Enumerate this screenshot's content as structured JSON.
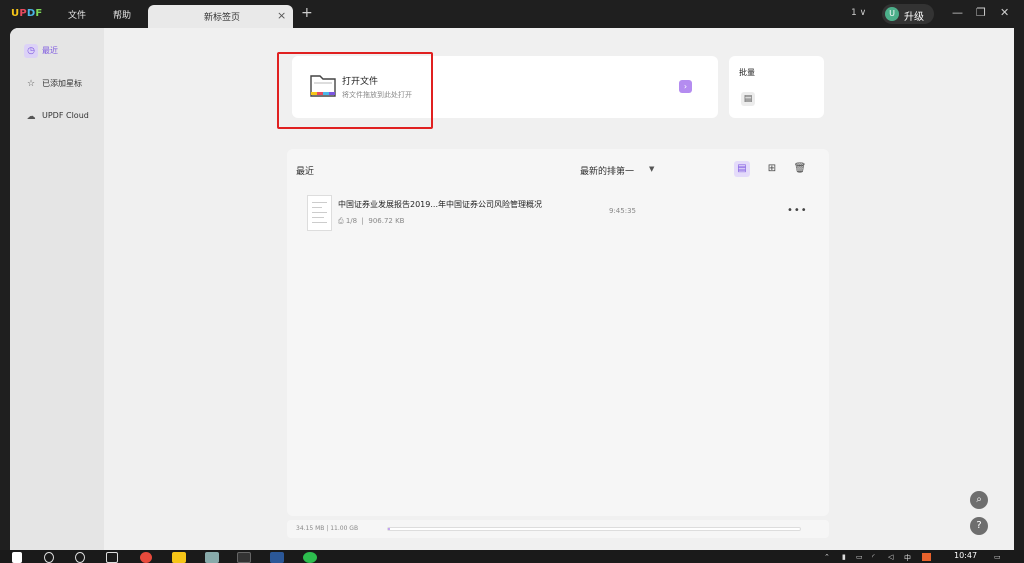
{
  "app": {
    "logo": [
      "U",
      "P",
      "D",
      "F"
    ],
    "menu": [
      "文件",
      "帮助"
    ],
    "tab_title": "新标签页",
    "tab_close": "×",
    "tab_add": "+",
    "version_selector": "1 ∨",
    "user_initial": "U",
    "upgrade_label": "升级"
  },
  "sidebar": {
    "items": [
      {
        "label": "最近",
        "icon": "clock-icon",
        "active": true
      },
      {
        "label": "已添加星标",
        "icon": "star-icon",
        "active": false
      },
      {
        "label": "UPDF Cloud",
        "icon": "cloud-icon",
        "active": false
      }
    ]
  },
  "open_file": {
    "title": "打开文件",
    "subtitle": "将文件拖放到此处打开",
    "arrow": "›"
  },
  "batch": {
    "title": "批量"
  },
  "recent": {
    "title": "最近",
    "sort_label": "最新的排第一",
    "files": [
      {
        "name": "中国证券业发展报告2019...年中国证券公司风险管理概况",
        "pages": "1/8",
        "size": "906.72 KB",
        "time": "9:45:35"
      }
    ]
  },
  "storage": {
    "text": "34.15 MB | 11.00 GB",
    "used_fraction": 0.003
  },
  "taskbar": {
    "clock": "10:47",
    "ime": "中"
  },
  "colors": {
    "accent": "#7b55e0",
    "highlight_border": "#e02020"
  }
}
